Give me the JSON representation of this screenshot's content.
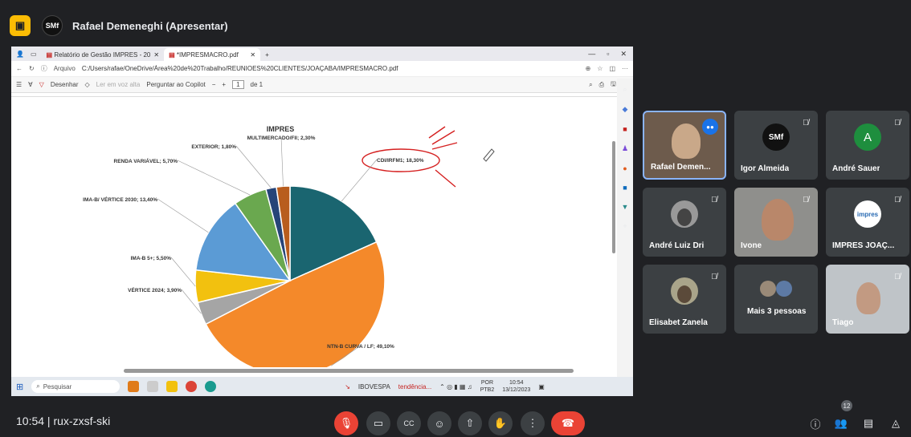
{
  "presenter": {
    "avatar_text": "SMf",
    "title": "Rafael Demeneghi (Apresentar)"
  },
  "browser": {
    "tabs": [
      {
        "label": "Relatório de Gestão IMPRES - 20"
      },
      {
        "label": "*IMPRESMACRO.pdf"
      }
    ],
    "address_prefix": "Arquivo",
    "address": "C:/Users/rafae/OneDrive/Área%20de%20Trabalho/REUNIOES%20CLIENTES/JOAÇABA/IMPRESMACRO.pdf",
    "toolbar": {
      "draw": "Desenhar",
      "read": "Ler em voz alta",
      "copilot": "Perguntar ao Copilot",
      "page": "1",
      "page_of": "de 1"
    }
  },
  "chart_data": {
    "type": "pie",
    "title": "IMPRES",
    "slices": [
      {
        "label": "CDI/IRFM1; 18,30%",
        "value": 18.3,
        "color": "#1a6570"
      },
      {
        "label": "NTN-B CURVA / LF; 49,10%",
        "value": 49.1,
        "color": "#f4892a"
      },
      {
        "label": "VÉRTICE 2024; 3,90%",
        "value": 3.9,
        "color": "#a5a5a5"
      },
      {
        "label": "IMA-B 5+; 5,50%",
        "value": 5.5,
        "color": "#f2c10f"
      },
      {
        "label": "IMA-B/ VÉRTICE 2030; 13,40%",
        "value": 13.4,
        "color": "#5b9bd5"
      },
      {
        "label": "RENDA VARIÁVEL; 5,70%",
        "value": 5.7,
        "color": "#6aa84f"
      },
      {
        "label": "EXTERIOR; 1,80%",
        "value": 1.8,
        "color": "#264478"
      },
      {
        "label": "MULTIMERCADO/FII; 2,30%",
        "value": 2.3,
        "color": "#b85d1e"
      }
    ]
  },
  "taskbar": {
    "search": "Pesquisar",
    "stock": "IBOVESPA",
    "stock_trend": "tendência...",
    "lang": "POR",
    "layout": "PTB2",
    "clock": "10:54",
    "date": "13/12/2023"
  },
  "participants": [
    {
      "name": "Rafael Demen...",
      "kind": "video",
      "initial": ""
    },
    {
      "name": "Igor Almeida",
      "kind": "logo",
      "initial": "SMf"
    },
    {
      "name": "André Sauer",
      "kind": "letter",
      "initial": "A"
    },
    {
      "name": "André Luiz Dri",
      "kind": "photo",
      "initial": ""
    },
    {
      "name": "Ivone",
      "kind": "video",
      "initial": ""
    },
    {
      "name": "IMPRES JOAÇ...",
      "kind": "logo",
      "initial": "impres"
    },
    {
      "name": "Elisabet Zanela",
      "kind": "photo",
      "initial": ""
    },
    {
      "name": "Mais 3 pessoas",
      "kind": "group",
      "initial": ""
    },
    {
      "name": "Tiago",
      "kind": "video",
      "initial": ""
    }
  ],
  "meeting": {
    "time": "10:54",
    "code": "rux-zxsf-ski",
    "people_count": "12"
  }
}
